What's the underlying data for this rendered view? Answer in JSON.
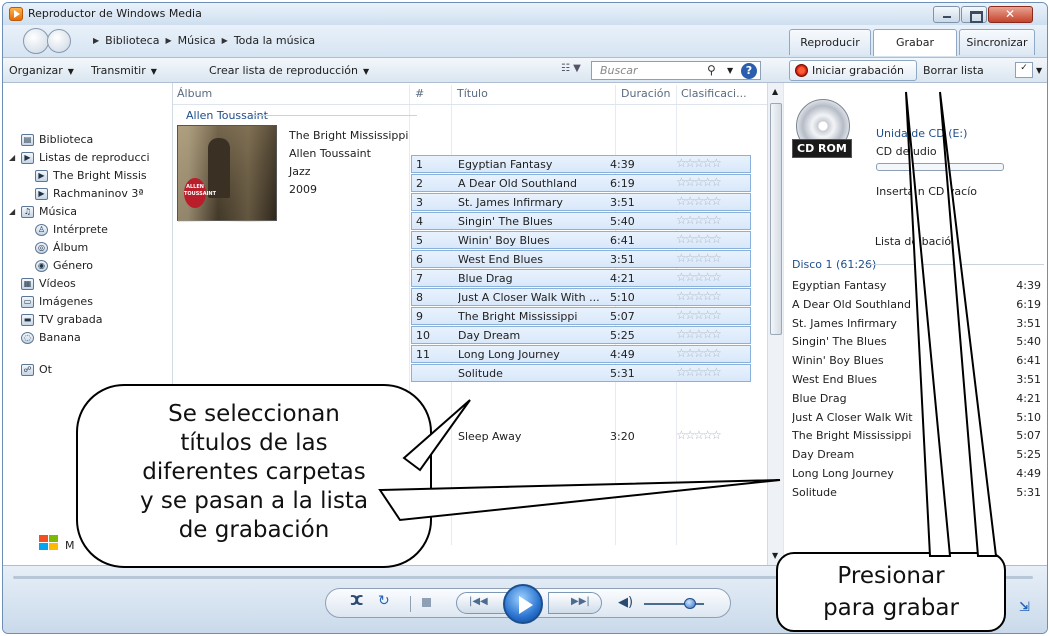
{
  "window": {
    "title": "Reproductor de Windows Media"
  },
  "breadcrumb": [
    "Biblioteca",
    "Música",
    "Toda la música"
  ],
  "tabs": [
    {
      "label": "Reproducir"
    },
    {
      "label": "Grabar",
      "selected": true
    },
    {
      "label": "Sincronizar"
    }
  ],
  "toolbar": {
    "organize": "Organizar",
    "stream": "Transmitir",
    "create_playlist": "Crear lista de reproducción",
    "search_placeholder": "Buscar",
    "start_burn": "Iniciar grabación",
    "clear_list": "Borrar lista"
  },
  "nav": {
    "items": [
      {
        "label": "Biblioteca",
        "icon": "library-icon"
      },
      {
        "label": "Listas de reproducci",
        "icon": "playlist-icon",
        "expanded": true
      },
      {
        "label": "The Bright Missis",
        "icon": "playlist-icon"
      },
      {
        "label": "Rachmaninov 3ª",
        "icon": "playlist-icon"
      },
      {
        "label": "Música",
        "icon": "music-icon",
        "expanded": true
      },
      {
        "label": "Intérprete",
        "icon": "artist-icon"
      },
      {
        "label": "Álbum",
        "icon": "album-icon"
      },
      {
        "label": "Género",
        "icon": "genre-icon"
      },
      {
        "label": "Vídeos",
        "icon": "video-icon"
      },
      {
        "label": "Imágenes",
        "icon": "picture-icon"
      },
      {
        "label": "TV grabada",
        "icon": "tv-icon"
      },
      {
        "label": "Banana",
        "icon": "device-icon"
      },
      {
        "label": "Ot",
        "icon": "other-libraries-icon"
      }
    ],
    "footer": "M"
  },
  "library": {
    "columns": [
      "Álbum",
      "#",
      "Título",
      "Duración",
      "Clasificaci..."
    ],
    "album_artist": "Allen Toussaint",
    "album": {
      "title": "The Bright Mississippi",
      "artist": "Allen Toussaint",
      "genre": "Jazz",
      "year": "2009",
      "cover_text": "ALLEN TOUSSAINT"
    },
    "tracks": [
      {
        "num": "1",
        "title": "Egyptian Fantasy",
        "duration": "4:39",
        "rating": "☆☆☆☆☆"
      },
      {
        "num": "2",
        "title": "A Dear Old Southland",
        "duration": "6:19",
        "rating": "☆☆☆☆☆"
      },
      {
        "num": "3",
        "title": "St. James Infirmary",
        "duration": "3:51",
        "rating": "☆☆☆☆☆"
      },
      {
        "num": "4",
        "title": "Singin' The Blues",
        "duration": "5:40",
        "rating": "☆☆☆☆☆"
      },
      {
        "num": "5",
        "title": "Winin' Boy Blues",
        "duration": "6:41",
        "rating": "☆☆☆☆☆"
      },
      {
        "num": "6",
        "title": "West End Blues",
        "duration": "3:51",
        "rating": "☆☆☆☆☆"
      },
      {
        "num": "7",
        "title": "Blue Drag",
        "duration": "4:21",
        "rating": "☆☆☆☆☆"
      },
      {
        "num": "8",
        "title": "Just A Closer Walk With ...",
        "duration": "5:10",
        "rating": "☆☆☆☆☆"
      },
      {
        "num": "9",
        "title": "The Bright Mississippi",
        "duration": "5:07",
        "rating": "☆☆☆☆☆"
      },
      {
        "num": "10",
        "title": "Day Dream",
        "duration": "5:25",
        "rating": "☆☆☆☆☆"
      },
      {
        "num": "11",
        "title": "Long Long Journey",
        "duration": "4:49",
        "rating": "☆☆☆☆☆"
      },
      {
        "num": "",
        "title": "Solitude",
        "duration": "5:31",
        "rating": "☆☆☆☆☆"
      }
    ],
    "extra_track": {
      "title": "Sleep Away",
      "duration": "3:20",
      "rating": "☆☆☆☆☆"
    }
  },
  "burn": {
    "drive_name": "Unida  de CD (E:)",
    "disc_type": "CD de  udio",
    "cd_label": "CD ROM",
    "insert_text": "Inserta   n CD vacío",
    "list_title": "Lista de     bación",
    "disc_header": "Disco 1 (61:26)",
    "tracks": [
      {
        "title": "Egyptian Fantasy",
        "duration": "4:39"
      },
      {
        "title": "A Dear Old Southland",
        "duration": "6:19"
      },
      {
        "title": "St. James Infirmary",
        "duration": "3:51"
      },
      {
        "title": "Singin' The Blues",
        "duration": "5:40"
      },
      {
        "title": "Winin' Boy Blues",
        "duration": "6:41"
      },
      {
        "title": "West End Blues",
        "duration": "3:51"
      },
      {
        "title": "Blue Drag",
        "duration": "4:21"
      },
      {
        "title": "Just A Closer Walk Wit",
        "duration": "5:10"
      },
      {
        "title": "The Bright Mississippi",
        "duration": "5:07"
      },
      {
        "title": "Day Dream",
        "duration": "5:25"
      },
      {
        "title": "Long Long Journey",
        "duration": "4:49"
      },
      {
        "title": "Solitude",
        "duration": "5:31"
      }
    ]
  },
  "callouts": {
    "select": [
      "Se seleccionan",
      "títulos de las",
      "diferentes carpetas",
      "y se pasan a la lista",
      "de grabación"
    ],
    "press": [
      "Presionar",
      "para grabar"
    ]
  },
  "colors": {
    "accent": "#1f4e8c",
    "selected_row": "#d8e8fa",
    "record": "#d52a0a"
  }
}
